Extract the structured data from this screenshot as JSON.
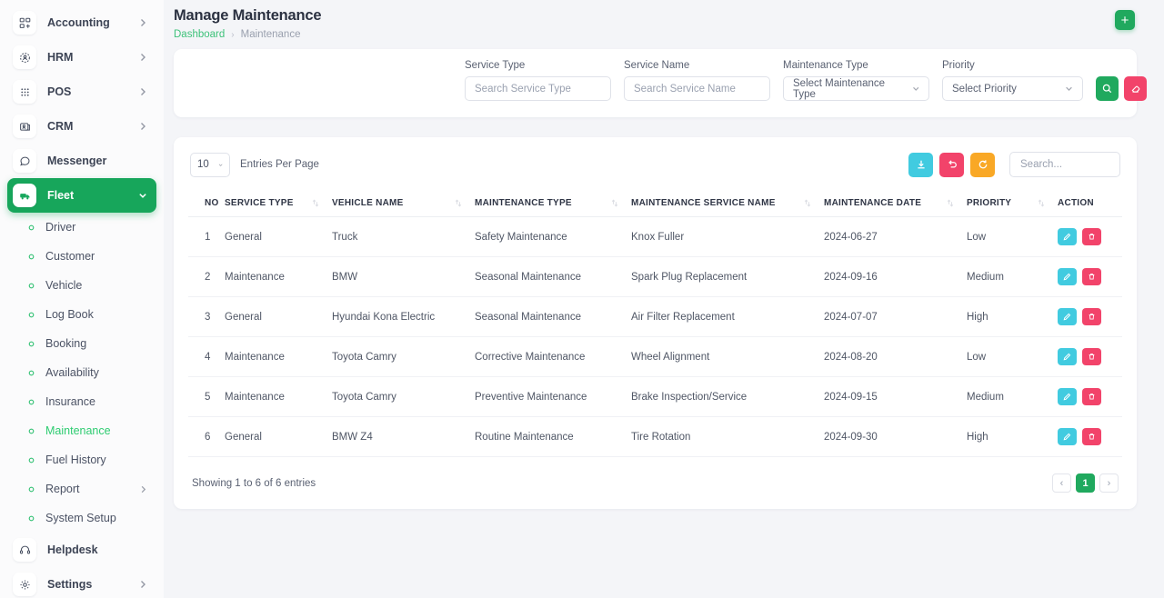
{
  "sidebar": {
    "items": [
      {
        "label": "Accounting",
        "icon": "grid-plus-icon",
        "chevron": true
      },
      {
        "label": "HRM",
        "icon": "people-circle-icon",
        "chevron": true
      },
      {
        "label": "POS",
        "icon": "dots-grid-icon",
        "chevron": true
      },
      {
        "label": "CRM",
        "icon": "contact-card-icon",
        "chevron": true
      },
      {
        "label": "Messenger",
        "icon": "chat-bubble-icon",
        "chevron": false
      },
      {
        "label": "Fleet",
        "icon": "truck-icon",
        "chevron": true,
        "active": true
      }
    ],
    "sub_items": [
      {
        "label": "Driver",
        "chevron": false
      },
      {
        "label": "Customer",
        "chevron": false
      },
      {
        "label": "Vehicle",
        "chevron": false
      },
      {
        "label": "Log Book",
        "chevron": false
      },
      {
        "label": "Booking",
        "chevron": false
      },
      {
        "label": "Availability",
        "chevron": false
      },
      {
        "label": "Insurance",
        "chevron": false
      },
      {
        "label": "Maintenance",
        "chevron": false,
        "current": true
      },
      {
        "label": "Fuel History",
        "chevron": false
      },
      {
        "label": "Report",
        "chevron": true
      },
      {
        "label": "System Setup",
        "chevron": false
      }
    ],
    "bottom_items": [
      {
        "label": "Helpdesk",
        "icon": "headset-icon",
        "chevron": false
      },
      {
        "label": "Settings",
        "icon": "gear-icon",
        "chevron": true
      }
    ]
  },
  "header": {
    "title": "Manage Maintenance",
    "breadcrumb_root": "Dashboard",
    "breadcrumb_sep": "›",
    "breadcrumb_current": "Maintenance",
    "add_label": "+"
  },
  "filters": {
    "service_type": {
      "label": "Service Type",
      "placeholder": "Search Service Type",
      "value": ""
    },
    "service_name": {
      "label": "Service Name",
      "placeholder": "Search Service Name",
      "value": ""
    },
    "maintenance_type": {
      "label": "Maintenance Type",
      "selected": "Select Maintenance Type"
    },
    "priority": {
      "label": "Priority",
      "selected": "Select Priority"
    }
  },
  "table_controls": {
    "entries_value": "10",
    "entries_label": "Entries Per Page",
    "search_placeholder": "Search...",
    "search_value": ""
  },
  "table": {
    "columns": [
      {
        "label": "NO",
        "sortable": false
      },
      {
        "label": "SERVICE TYPE",
        "sortable": true
      },
      {
        "label": "VEHICLE NAME",
        "sortable": true
      },
      {
        "label": "MAINTENANCE TYPE",
        "sortable": true
      },
      {
        "label": "MAINTENANCE SERVICE NAME",
        "sortable": true
      },
      {
        "label": "MAINTENANCE DATE",
        "sortable": true
      },
      {
        "label": "PRIORITY",
        "sortable": true
      },
      {
        "label": "ACTION",
        "sortable": false
      }
    ],
    "rows": [
      {
        "no": "1",
        "service_type": "General",
        "vehicle_name": "Truck",
        "maintenance_type": "Safety Maintenance",
        "service_name": "Knox Fuller",
        "date": "2024-06-27",
        "priority": "Low"
      },
      {
        "no": "2",
        "service_type": "Maintenance",
        "vehicle_name": "BMW",
        "maintenance_type": "Seasonal Maintenance",
        "service_name": "Spark Plug Replacement",
        "date": "2024-09-16",
        "priority": "Medium"
      },
      {
        "no": "3",
        "service_type": "General",
        "vehicle_name": "Hyundai Kona Electric",
        "maintenance_type": "Seasonal Maintenance",
        "service_name": "Air Filter Replacement",
        "date": "2024-07-07",
        "priority": "High"
      },
      {
        "no": "4",
        "service_type": "Maintenance",
        "vehicle_name": "Toyota Camry",
        "maintenance_type": "Corrective Maintenance",
        "service_name": "Wheel Alignment",
        "date": "2024-08-20",
        "priority": "Low"
      },
      {
        "no": "5",
        "service_type": "Maintenance",
        "vehicle_name": "Toyota Camry",
        "maintenance_type": "Preventive Maintenance",
        "service_name": "Brake Inspection/Service",
        "date": "2024-09-15",
        "priority": "Medium"
      },
      {
        "no": "6",
        "service_type": "General",
        "vehicle_name": "BMW Z4",
        "maintenance_type": "Routine Maintenance",
        "service_name": "Tire Rotation",
        "date": "2024-09-30",
        "priority": "High"
      }
    ]
  },
  "footer": {
    "showing": "Showing 1 to 6 of 6 entries",
    "prev": "‹",
    "page": "1",
    "next": "›"
  },
  "colors": {
    "brand_green": "#20a95e",
    "pink": "#f2436a",
    "cyan": "#41cbe0",
    "orange": "#f9a826",
    "link_green": "#3ec27a"
  }
}
